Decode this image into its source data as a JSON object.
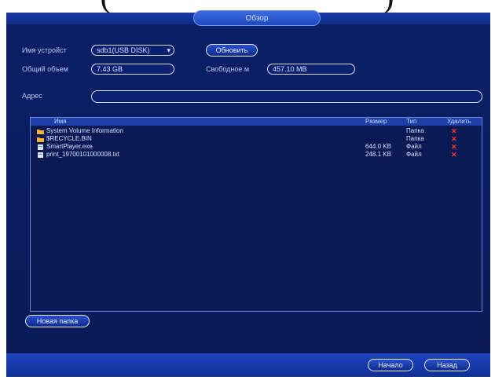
{
  "caption": {
    "text": "(                              )"
  },
  "window": {
    "title": "Обзор"
  },
  "device": {
    "name_label": "Имя устройст",
    "name_value": "sdb1(USB DISK)",
    "name_arrow": "▾",
    "total_label": "Общий объем",
    "total_value": "7.43 GB",
    "refresh_label": "Обновить",
    "free_label": "Свободное м",
    "free_value": "457.10 MB"
  },
  "address": {
    "label": "Адрес",
    "value": ""
  },
  "table": {
    "headers": {
      "name": "Имя",
      "size": "Размер",
      "type": "Тип",
      "delete": "Удалить"
    },
    "rows": [
      {
        "name": "System Volume Information",
        "size": "",
        "type": "Папка",
        "icon": "folder-icon",
        "delete": "✕"
      },
      {
        "name": "$RECYCLE.BIN",
        "size": "",
        "type": "Папка",
        "icon": "folder-icon",
        "delete": "✕"
      },
      {
        "name": "SmartPlayer.exe",
        "size": "644.0 KB",
        "type": "Файл",
        "icon": "file-icon",
        "delete": "✕"
      },
      {
        "name": "print_19700101000008.txt",
        "size": "248.1 KB",
        "type": "Файл",
        "icon": "file-icon",
        "delete": "✕"
      }
    ]
  },
  "actions": {
    "new_folder": "Новая папка",
    "start": "Начало",
    "back": "Назад"
  },
  "colors": {
    "panel": "#0a1c5e",
    "header": "#1f3fa8",
    "delete": "#ff3b1f",
    "folder": "#f2b233"
  }
}
